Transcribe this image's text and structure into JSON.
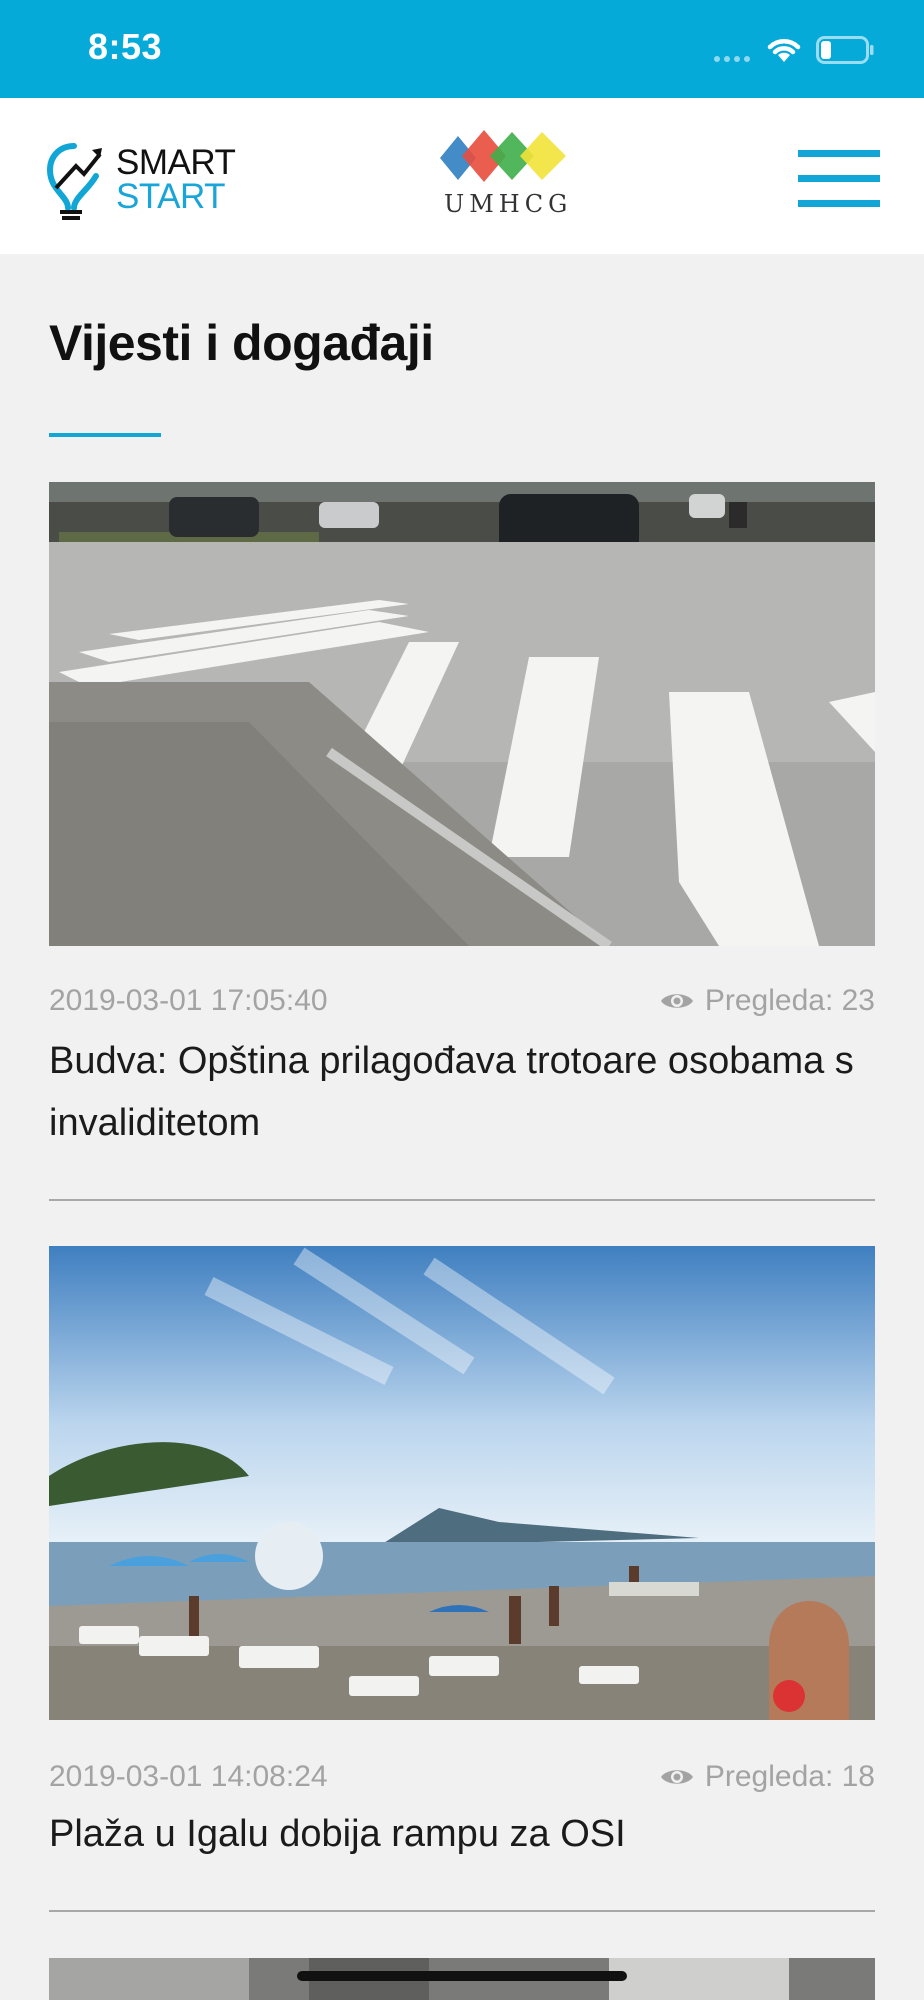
{
  "status_bar": {
    "time": "8:53",
    "icons": [
      "signal-dots-icon",
      "wifi-icon",
      "battery-icon"
    ]
  },
  "header": {
    "smart_start_line1": "SMART",
    "smart_start_line2": "START",
    "umhcg_label": "UMHCG",
    "menu_icon": "hamburger-menu-icon"
  },
  "page": {
    "title": "Vijesti i događaji"
  },
  "articles": [
    {
      "date": "2019-03-01 17:05:40",
      "views": "Pregleda: 23",
      "title": "Budva: Opština prilagođava trotoare osobama s invaliditetom",
      "image": "crosswalk-street-photo"
    },
    {
      "date": "2019-03-01 14:08:24",
      "views": "Pregleda: 18",
      "title": "Plaža u Igalu dobija rampu za OSI",
      "image": "beach-igalo-photo"
    }
  ],
  "colors": {
    "accent": "#05aad9",
    "background": "#f1f1f1",
    "meta_text": "#a3a3a3"
  }
}
